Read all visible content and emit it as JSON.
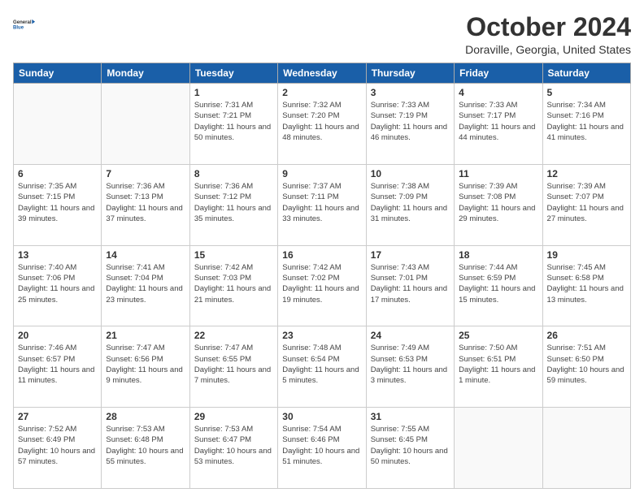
{
  "header": {
    "logo_line1": "General",
    "logo_line2": "Blue",
    "month_title": "October 2024",
    "location": "Doraville, Georgia, United States"
  },
  "days_of_week": [
    "Sunday",
    "Monday",
    "Tuesday",
    "Wednesday",
    "Thursday",
    "Friday",
    "Saturday"
  ],
  "weeks": [
    [
      {
        "day": "",
        "sunrise": "",
        "sunset": "",
        "daylight": "",
        "empty": true
      },
      {
        "day": "",
        "sunrise": "",
        "sunset": "",
        "daylight": "",
        "empty": true
      },
      {
        "day": "1",
        "sunrise": "Sunrise: 7:31 AM",
        "sunset": "Sunset: 7:21 PM",
        "daylight": "Daylight: 11 hours and 50 minutes."
      },
      {
        "day": "2",
        "sunrise": "Sunrise: 7:32 AM",
        "sunset": "Sunset: 7:20 PM",
        "daylight": "Daylight: 11 hours and 48 minutes."
      },
      {
        "day": "3",
        "sunrise": "Sunrise: 7:33 AM",
        "sunset": "Sunset: 7:19 PM",
        "daylight": "Daylight: 11 hours and 46 minutes."
      },
      {
        "day": "4",
        "sunrise": "Sunrise: 7:33 AM",
        "sunset": "Sunset: 7:17 PM",
        "daylight": "Daylight: 11 hours and 44 minutes."
      },
      {
        "day": "5",
        "sunrise": "Sunrise: 7:34 AM",
        "sunset": "Sunset: 7:16 PM",
        "daylight": "Daylight: 11 hours and 41 minutes."
      }
    ],
    [
      {
        "day": "6",
        "sunrise": "Sunrise: 7:35 AM",
        "sunset": "Sunset: 7:15 PM",
        "daylight": "Daylight: 11 hours and 39 minutes."
      },
      {
        "day": "7",
        "sunrise": "Sunrise: 7:36 AM",
        "sunset": "Sunset: 7:13 PM",
        "daylight": "Daylight: 11 hours and 37 minutes."
      },
      {
        "day": "8",
        "sunrise": "Sunrise: 7:36 AM",
        "sunset": "Sunset: 7:12 PM",
        "daylight": "Daylight: 11 hours and 35 minutes."
      },
      {
        "day": "9",
        "sunrise": "Sunrise: 7:37 AM",
        "sunset": "Sunset: 7:11 PM",
        "daylight": "Daylight: 11 hours and 33 minutes."
      },
      {
        "day": "10",
        "sunrise": "Sunrise: 7:38 AM",
        "sunset": "Sunset: 7:09 PM",
        "daylight": "Daylight: 11 hours and 31 minutes."
      },
      {
        "day": "11",
        "sunrise": "Sunrise: 7:39 AM",
        "sunset": "Sunset: 7:08 PM",
        "daylight": "Daylight: 11 hours and 29 minutes."
      },
      {
        "day": "12",
        "sunrise": "Sunrise: 7:39 AM",
        "sunset": "Sunset: 7:07 PM",
        "daylight": "Daylight: 11 hours and 27 minutes."
      }
    ],
    [
      {
        "day": "13",
        "sunrise": "Sunrise: 7:40 AM",
        "sunset": "Sunset: 7:06 PM",
        "daylight": "Daylight: 11 hours and 25 minutes."
      },
      {
        "day": "14",
        "sunrise": "Sunrise: 7:41 AM",
        "sunset": "Sunset: 7:04 PM",
        "daylight": "Daylight: 11 hours and 23 minutes."
      },
      {
        "day": "15",
        "sunrise": "Sunrise: 7:42 AM",
        "sunset": "Sunset: 7:03 PM",
        "daylight": "Daylight: 11 hours and 21 minutes."
      },
      {
        "day": "16",
        "sunrise": "Sunrise: 7:42 AM",
        "sunset": "Sunset: 7:02 PM",
        "daylight": "Daylight: 11 hours and 19 minutes."
      },
      {
        "day": "17",
        "sunrise": "Sunrise: 7:43 AM",
        "sunset": "Sunset: 7:01 PM",
        "daylight": "Daylight: 11 hours and 17 minutes."
      },
      {
        "day": "18",
        "sunrise": "Sunrise: 7:44 AM",
        "sunset": "Sunset: 6:59 PM",
        "daylight": "Daylight: 11 hours and 15 minutes."
      },
      {
        "day": "19",
        "sunrise": "Sunrise: 7:45 AM",
        "sunset": "Sunset: 6:58 PM",
        "daylight": "Daylight: 11 hours and 13 minutes."
      }
    ],
    [
      {
        "day": "20",
        "sunrise": "Sunrise: 7:46 AM",
        "sunset": "Sunset: 6:57 PM",
        "daylight": "Daylight: 11 hours and 11 minutes."
      },
      {
        "day": "21",
        "sunrise": "Sunrise: 7:47 AM",
        "sunset": "Sunset: 6:56 PM",
        "daylight": "Daylight: 11 hours and 9 minutes."
      },
      {
        "day": "22",
        "sunrise": "Sunrise: 7:47 AM",
        "sunset": "Sunset: 6:55 PM",
        "daylight": "Daylight: 11 hours and 7 minutes."
      },
      {
        "day": "23",
        "sunrise": "Sunrise: 7:48 AM",
        "sunset": "Sunset: 6:54 PM",
        "daylight": "Daylight: 11 hours and 5 minutes."
      },
      {
        "day": "24",
        "sunrise": "Sunrise: 7:49 AM",
        "sunset": "Sunset: 6:53 PM",
        "daylight": "Daylight: 11 hours and 3 minutes."
      },
      {
        "day": "25",
        "sunrise": "Sunrise: 7:50 AM",
        "sunset": "Sunset: 6:51 PM",
        "daylight": "Daylight: 11 hours and 1 minute."
      },
      {
        "day": "26",
        "sunrise": "Sunrise: 7:51 AM",
        "sunset": "Sunset: 6:50 PM",
        "daylight": "Daylight: 10 hours and 59 minutes."
      }
    ],
    [
      {
        "day": "27",
        "sunrise": "Sunrise: 7:52 AM",
        "sunset": "Sunset: 6:49 PM",
        "daylight": "Daylight: 10 hours and 57 minutes."
      },
      {
        "day": "28",
        "sunrise": "Sunrise: 7:53 AM",
        "sunset": "Sunset: 6:48 PM",
        "daylight": "Daylight: 10 hours and 55 minutes."
      },
      {
        "day": "29",
        "sunrise": "Sunrise: 7:53 AM",
        "sunset": "Sunset: 6:47 PM",
        "daylight": "Daylight: 10 hours and 53 minutes."
      },
      {
        "day": "30",
        "sunrise": "Sunrise: 7:54 AM",
        "sunset": "Sunset: 6:46 PM",
        "daylight": "Daylight: 10 hours and 51 minutes."
      },
      {
        "day": "31",
        "sunrise": "Sunrise: 7:55 AM",
        "sunset": "Sunset: 6:45 PM",
        "daylight": "Daylight: 10 hours and 50 minutes."
      },
      {
        "day": "",
        "sunrise": "",
        "sunset": "",
        "daylight": "",
        "empty": true
      },
      {
        "day": "",
        "sunrise": "",
        "sunset": "",
        "daylight": "",
        "empty": true
      }
    ]
  ]
}
